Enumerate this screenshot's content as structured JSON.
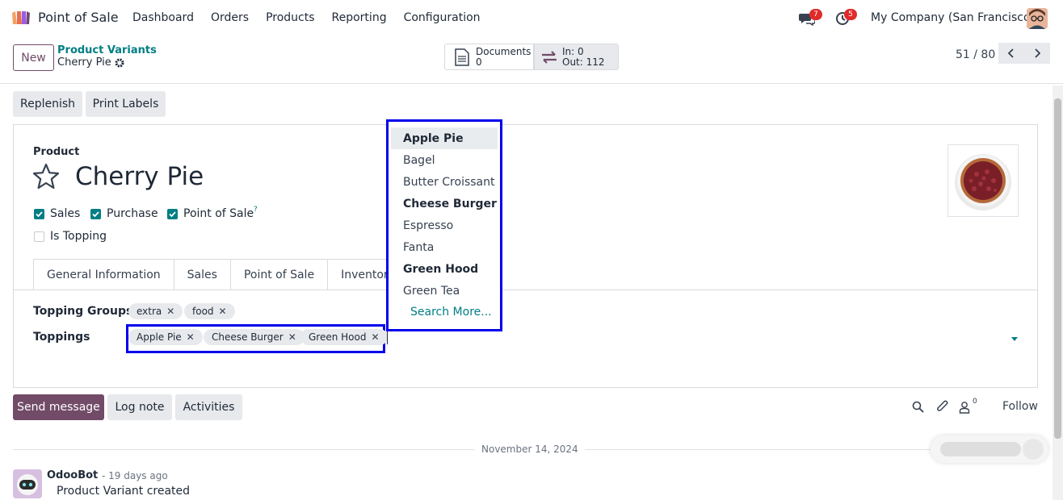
{
  "navbar": {
    "app_name": "Point of Sale",
    "menu": [
      "Dashboard",
      "Orders",
      "Products",
      "Reporting",
      "Configuration"
    ],
    "messages_count": "7",
    "activities_count": "5",
    "company": "My Company (San Francisco)"
  },
  "control": {
    "new_label": "New",
    "breadcrumb_parent": "Product Variants",
    "breadcrumb_current": "Cherry Pie",
    "documents_label": "Documents",
    "documents_count": "0",
    "moves_in": "In: 0",
    "moves_out": "Out: 112",
    "pager": "51 / 80"
  },
  "actions": {
    "replenish": "Replenish",
    "print_labels": "Print Labels"
  },
  "form": {
    "product_label": "Product",
    "product_name": "Cherry Pie",
    "checks": [
      {
        "label": "Sales",
        "checked": true
      },
      {
        "label": "Purchase",
        "checked": true
      },
      {
        "label": "Point of Sale",
        "checked": true
      },
      {
        "label": "Is Topping",
        "checked": false
      }
    ],
    "pos_help": "?",
    "tabs": [
      "General Information",
      "Sales",
      "Point of Sale",
      "Inventory"
    ],
    "topping_groups_label": "Topping Groups",
    "topping_groups": [
      "extra",
      "food"
    ],
    "toppings_label": "Toppings",
    "toppings": [
      "Apple Pie",
      "Cheese Burger",
      "Green Hood"
    ]
  },
  "dropdown": {
    "items": [
      {
        "label": "Apple Pie",
        "bold": true,
        "active": true
      },
      {
        "label": "Bagel",
        "bold": false,
        "active": false
      },
      {
        "label": "Butter Croissant",
        "bold": false,
        "active": false
      },
      {
        "label": "Cheese Burger",
        "bold": true,
        "active": false
      },
      {
        "label": "Espresso",
        "bold": false,
        "active": false
      },
      {
        "label": "Fanta",
        "bold": false,
        "active": false
      },
      {
        "label": "Green Hood",
        "bold": true,
        "active": false
      },
      {
        "label": "Green Tea",
        "bold": false,
        "active": false
      }
    ],
    "search_more": "Search More..."
  },
  "chatter": {
    "send_message": "Send message",
    "log_note": "Log note",
    "activities": "Activities",
    "followers_count": "0",
    "follow": "Follow",
    "date": "November 14, 2024",
    "author": "OdooBot",
    "time": "- 19 days ago",
    "message": "Product Variant created"
  },
  "colors": {
    "primary": "#714b67",
    "accent": "#017e84",
    "badge": "#e02b2b",
    "highlight": "#0000ee"
  }
}
